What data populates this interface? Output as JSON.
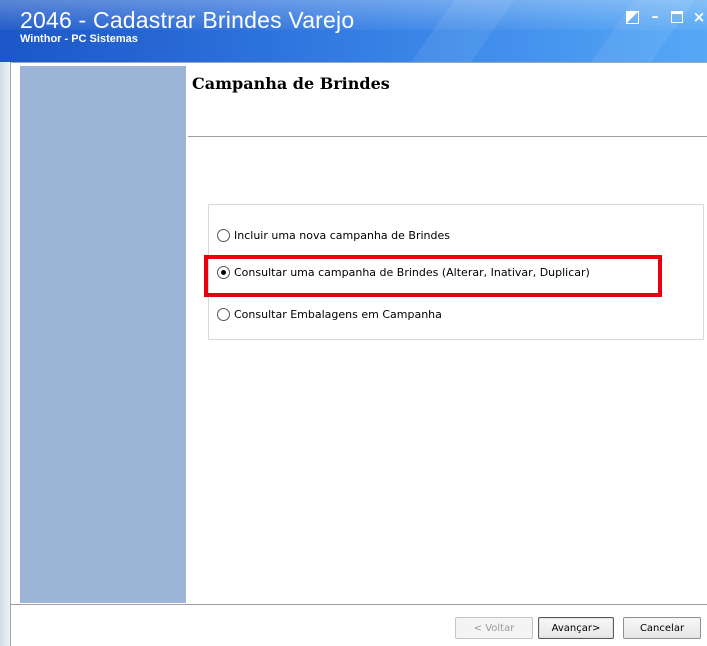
{
  "window": {
    "title": "2046 - Cadastrar Brindes Varejo",
    "subtitle": "Winthor - PC Sistemas",
    "controls": {
      "minimize": "–",
      "close": "×"
    }
  },
  "page": {
    "heading": "Campanha de Brindes"
  },
  "options": [
    {
      "label": "Incluir uma nova campanha de Brindes",
      "checked": false
    },
    {
      "label": "Consultar uma campanha de Brindes (Alterar, Inativar, Duplicar)",
      "checked": true
    },
    {
      "label": "Consultar Embalagens em Campanha",
      "checked": false
    }
  ],
  "buttons": {
    "back": "< Voltar",
    "next": "Avançar>",
    "cancel": "Cancelar"
  },
  "colors": {
    "titlebar": "#2a6cd8",
    "sidebar": "#9cb5d6",
    "highlight": "#e8000f"
  }
}
